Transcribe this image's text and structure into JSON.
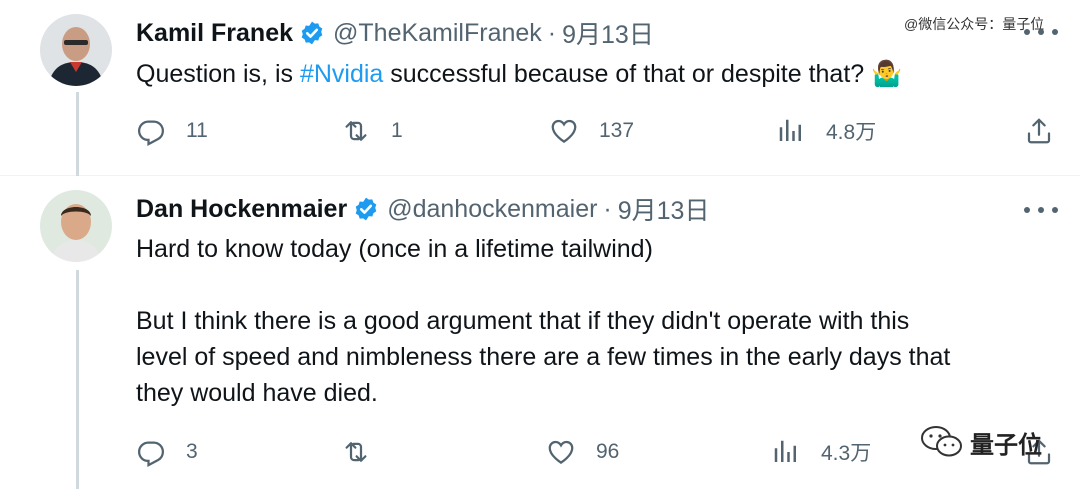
{
  "watermark": {
    "top_text": "@微信公众号：量子位",
    "logo_text": "量子位"
  },
  "tweets": [
    {
      "author_name": "Kamil Franek",
      "handle": "@TheKamilFranek",
      "separator": "·",
      "date": "9月13日",
      "text_before": "Question is, is ",
      "hashtag": "#Nvidia",
      "text_after": " successful because of that or despite that? ",
      "emoji": "🤷‍♂️",
      "replies": "11",
      "retweets": "1",
      "likes": "137",
      "views": "4.8万"
    },
    {
      "author_name": "Dan Hockenmaier",
      "handle": "@danhockenmaier",
      "separator": "·",
      "date": "9月13日",
      "paragraph1": "Hard to know today (once in a lifetime tailwind)",
      "paragraph2_line1": "But I think there is a good argument that if they didn't operate with this",
      "paragraph2_line2": "level of speed and nimbleness there are a few times in the early days that",
      "paragraph2_line3": "they would have died.",
      "replies": "3",
      "retweets": "",
      "likes": "96",
      "views": "4.3万"
    }
  ],
  "colors": {
    "text": "#0f1419",
    "muted": "#536471",
    "accent": "#1d9bf0",
    "thread_line": "#cfd9de"
  },
  "icons": [
    "verified-badge-icon",
    "more-icon",
    "reply-icon",
    "retweet-icon",
    "like-icon",
    "views-icon",
    "share-icon",
    "wechat-icon"
  ]
}
